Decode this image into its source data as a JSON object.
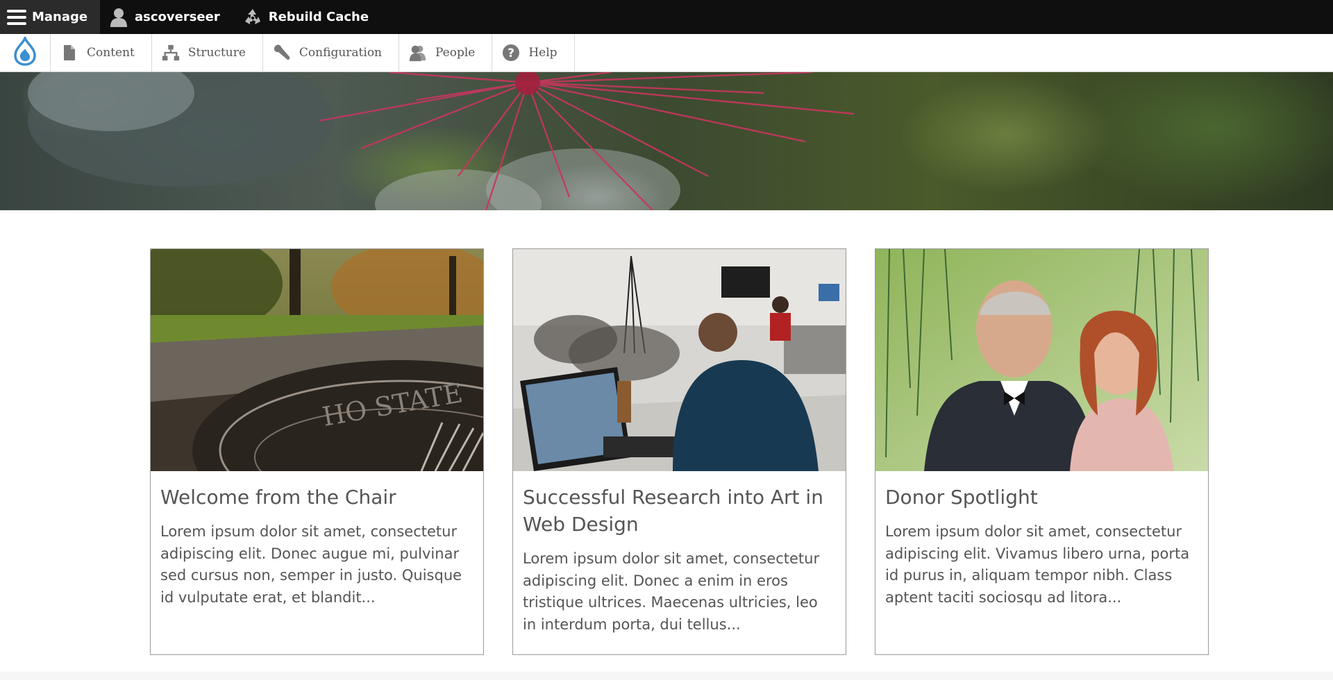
{
  "toolbar": {
    "manage_label": "Manage",
    "user_label": "ascoverseer",
    "rebuild_label": "Rebuild Cache"
  },
  "tray": {
    "items": [
      {
        "label": "Content",
        "icon": "file-icon"
      },
      {
        "label": "Structure",
        "icon": "sitemap-icon"
      },
      {
        "label": "Configuration",
        "icon": "wrench-icon"
      },
      {
        "label": "People",
        "icon": "people-icon"
      },
      {
        "label": "Help",
        "icon": "help-icon"
      }
    ]
  },
  "colors": {
    "toolbar_bg": "#0f0f0f",
    "manage_bg": "#2b2b2b",
    "drupal_blue": "#3c8fd1",
    "text_gray": "#555555"
  },
  "cards": [
    {
      "title": "Welcome from the Chair",
      "body": "Lorem ipsum dolor sit amet, consectetur adipiscing elit. Donec augue mi, pulvinar sed cursus non, semper in justo. Quisque id vulputate erat, et blandit..."
    },
    {
      "title": "Successful Research into Art in Web Design",
      "body": "Lorem ipsum dolor sit amet, consectetur adipiscing elit. Donec a enim in eros tristique ultrices. Maecenas ultricies, leo in interdum porta, dui tellus..."
    },
    {
      "title": "Donor Spotlight",
      "body": "Lorem ipsum dolor sit amet, consectetur adipiscing elit. Vivamus libero urna, porta id purus in, aliquam tempor nibh. Class aptent taciti sociosqu ad litora..."
    }
  ]
}
